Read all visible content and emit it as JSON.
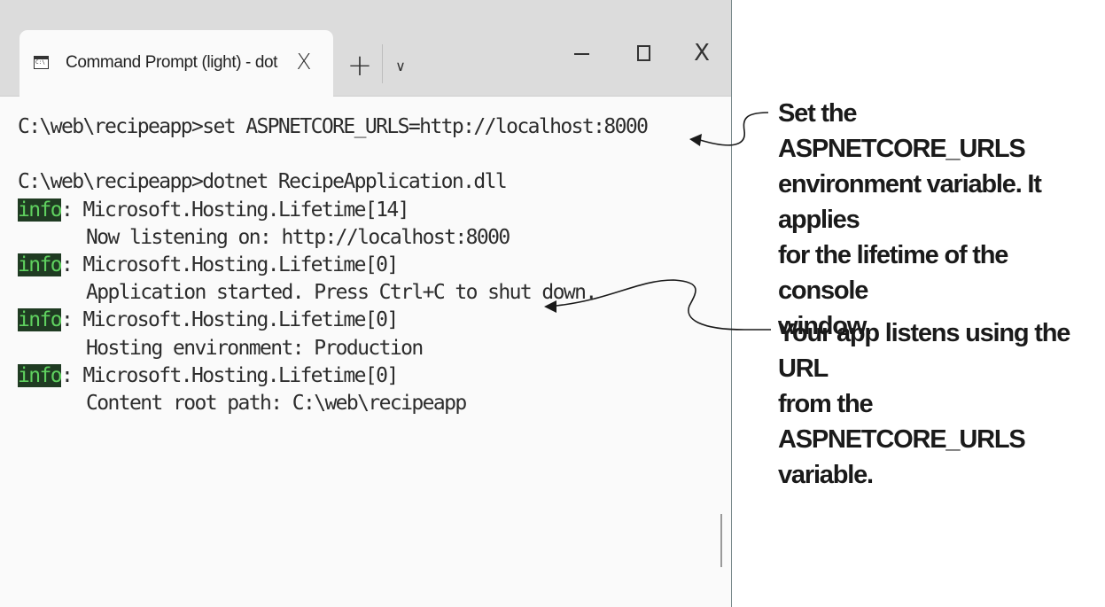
{
  "window": {
    "tab_title": "Command Prompt (light) - dot",
    "tab_icon_text": "C:\\",
    "tab_close_label": "X",
    "new_tab_label": "+",
    "dropdown_label": "∨",
    "close_label": "X"
  },
  "console": {
    "lines": [
      {
        "text": "C:\\web\\recipeapp>set ASPNETCORE_URLS=http://localhost:8000"
      },
      {
        "text": ""
      },
      {
        "text": "C:\\web\\recipeapp>dotnet RecipeApplication.dll"
      },
      {
        "badge": "info",
        "text": ": Microsoft.Hosting.Lifetime[14]"
      },
      {
        "text": "Now listening on: http://localhost:8000"
      },
      {
        "badge": "info",
        "text": ": Microsoft.Hosting.Lifetime[0]"
      },
      {
        "text": "Application started. Press Ctrl+C to shut down."
      },
      {
        "badge": "info",
        "text": ": Microsoft.Hosting.Lifetime[0]"
      },
      {
        "text": "Hosting environment: Production"
      },
      {
        "badge": "info",
        "text": ": Microsoft.Hosting.Lifetime[0]"
      },
      {
        "text": "Content root path: C:\\web\\recipeapp"
      }
    ]
  },
  "annotations": [
    {
      "lines": [
        "Set the ASPNETCORE_URLS",
        "environment variable. It applies",
        "for the lifetime of the console",
        "window."
      ]
    },
    {
      "lines": [
        "Your app listens using the URL",
        "from the ASPNETCORE_URLS",
        "variable."
      ]
    }
  ],
  "colors": {
    "badge_background": "#1f3b22",
    "badge_text": "#5fd15f",
    "console_text": "#2c2c2c",
    "annotation_text": "#1a1a1a"
  }
}
